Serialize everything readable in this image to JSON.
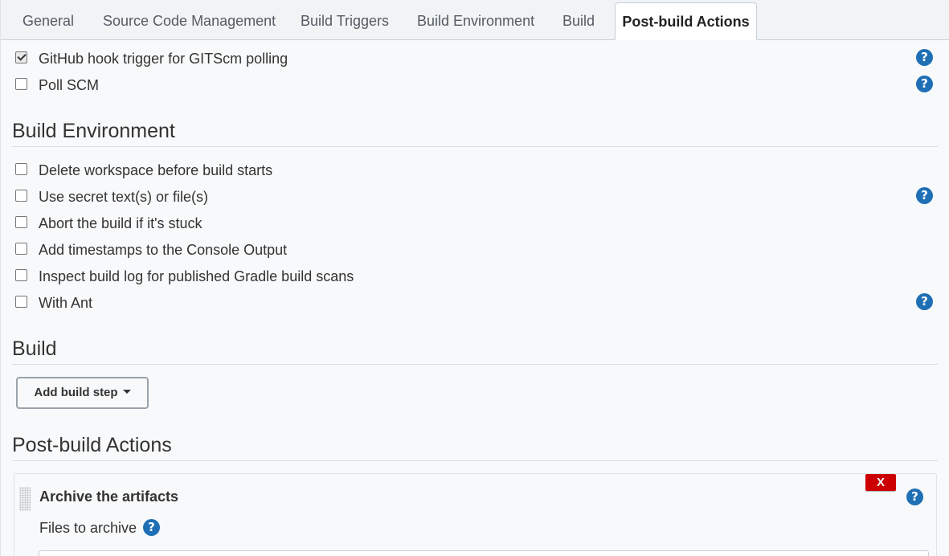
{
  "tabs": [
    {
      "label": "General",
      "active": false
    },
    {
      "label": "Source Code Management",
      "active": false
    },
    {
      "label": "Build Triggers",
      "active": false
    },
    {
      "label": "Build Environment",
      "active": false
    },
    {
      "label": "Build",
      "active": false
    },
    {
      "label": "Post-build Actions",
      "active": true
    }
  ],
  "build_triggers": {
    "items": [
      {
        "label": "GitHub hook trigger for GITScm polling",
        "checked": true,
        "help": true
      },
      {
        "label": "Poll SCM",
        "checked": false,
        "help": true
      }
    ]
  },
  "build_environment": {
    "title": "Build Environment",
    "items": [
      {
        "label": "Delete workspace before build starts",
        "checked": false,
        "help": false
      },
      {
        "label": "Use secret text(s) or file(s)",
        "checked": false,
        "help": true
      },
      {
        "label": "Abort the build if it's stuck",
        "checked": false,
        "help": false
      },
      {
        "label": "Add timestamps to the Console Output",
        "checked": false,
        "help": false
      },
      {
        "label": "Inspect build log for published Gradle build scans",
        "checked": false,
        "help": false
      },
      {
        "label": "With Ant",
        "checked": false,
        "help": true
      }
    ]
  },
  "build": {
    "title": "Build",
    "add_step_label": "Add build step"
  },
  "post_build": {
    "title": "Post-build Actions",
    "action": {
      "title": "Archive the artifacts",
      "delete_label": "X",
      "files_label": "Files to archive",
      "files_value": ""
    }
  },
  "icons": {
    "help": "help-icon",
    "checkbox": "checkbox",
    "caret": "caret-down-icon",
    "drag": "drag-handle-icon"
  },
  "colors": {
    "help_blue": "#1f6fb5",
    "delete_red": "#cc0000",
    "background": "#f8f9fa"
  }
}
